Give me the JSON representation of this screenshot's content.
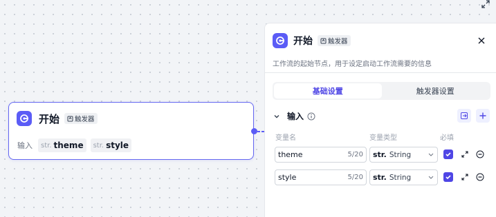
{
  "node": {
    "title": "开始",
    "tag": "触发器",
    "inputs_label": "输入",
    "inputs": [
      {
        "type": "str.",
        "name": "theme"
      },
      {
        "type": "str.",
        "name": "style"
      }
    ]
  },
  "panel": {
    "title": "开始",
    "tag": "触发器",
    "description": "工作流的起始节点，用于设定启动工作流需要的信息",
    "tabs": [
      {
        "label": "基础设置",
        "active": true
      },
      {
        "label": "触发器设置",
        "active": false
      }
    ],
    "section_title": "输入",
    "columns": {
      "name": "变量名",
      "type": "变量类型",
      "required": "必填"
    },
    "rows": [
      {
        "name": "theme",
        "count": "5/20",
        "type_prefix": "str.",
        "type": "String",
        "required": true
      },
      {
        "name": "style",
        "count": "5/20",
        "type_prefix": "str.",
        "type": "String",
        "required": true
      }
    ]
  },
  "colors": {
    "accent": "#5b5cf6",
    "checkbox": "#4f46e5",
    "border": "#e5e7eb"
  },
  "icons": [
    "fullscreen-icon",
    "node-start-icon",
    "trigger-tag-icon",
    "close-icon",
    "chevron-down-icon",
    "info-icon",
    "import-icon",
    "plus-icon",
    "expand-icon",
    "remove-icon",
    "check-icon"
  ]
}
